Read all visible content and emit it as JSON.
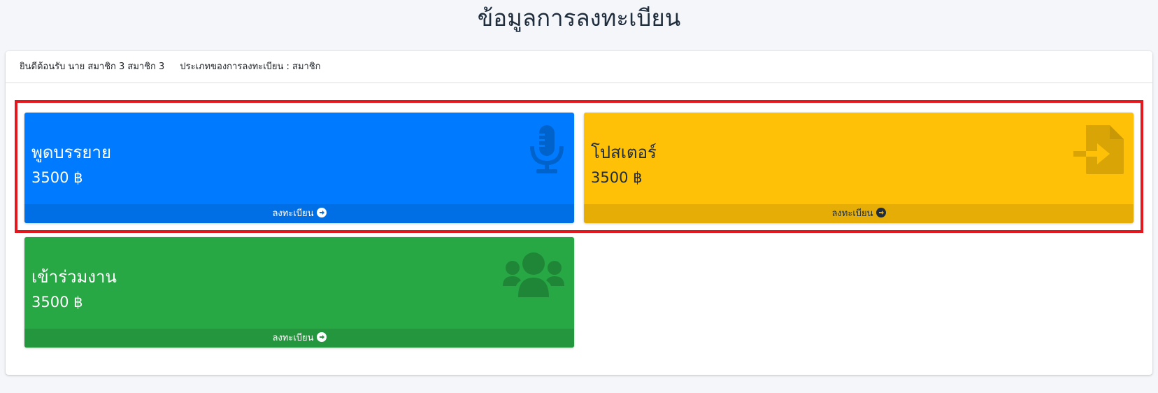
{
  "page": {
    "title": "ข้อมูลการลงทะเบียน"
  },
  "header": {
    "welcome": "ยินดีต้อนรับ นาย สมาชิก 3  สมาชิก 3",
    "registration_type": "ประเภทของการลงทะเบียน : สมาชิก"
  },
  "options": [
    {
      "title": "พูดบรรยาย",
      "price": "3500 ฿",
      "action": "ลงทะเบียน",
      "icon": "microphone-icon",
      "color": "#007bff"
    },
    {
      "title": "โปสเตอร์",
      "price": "3500 ฿",
      "action": "ลงทะเบียน",
      "icon": "file-import-icon",
      "color": "#ffc107"
    },
    {
      "title": "เข้าร่วมงาน",
      "price": "3500 ฿",
      "action": "ลงทะเบียน",
      "icon": "users-icon",
      "color": "#28a745"
    }
  ],
  "highlight_color": "#e3181e"
}
